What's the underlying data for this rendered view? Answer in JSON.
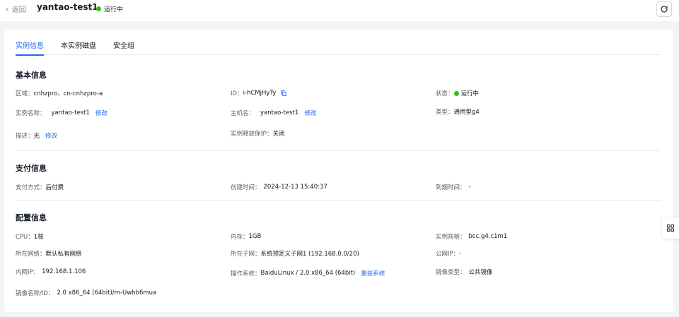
{
  "header": {
    "back_label": "返回",
    "instance_title": "yantao-test1",
    "status_text": "运行中",
    "status_color": "#30bf13"
  },
  "tabs": [
    {
      "label": "实例信息",
      "active": true
    },
    {
      "label": "本实例磁盘",
      "active": false
    },
    {
      "label": "安全组",
      "active": false
    }
  ],
  "basic": {
    "title": "基本信息",
    "region_label": "区域：",
    "region_value": "cnhzpro、cn-cnhzpro-a",
    "id_label": "ID：",
    "id_value": "i-hCMjHyTy",
    "state_label": "状态：",
    "state_value": "运行中",
    "name_label": "实例名称：",
    "name_value": "yantao-test1",
    "name_edit": "修改",
    "host_label": "主机名：",
    "host_value": "yantao-test1",
    "host_edit": "修改",
    "type_label": "类型：",
    "type_value": "通用型g4",
    "desc_label": "描述：",
    "desc_value": "无",
    "desc_edit": "修改",
    "protect_label": "实例释放保护：",
    "protect_value": "关闭"
  },
  "payment": {
    "title": "支付信息",
    "method_label": "支付方式：",
    "method_value": "后付费",
    "created_label": "创建时间：",
    "created_value": "2024-12-13 15:40:37",
    "expire_label": "到期时间：",
    "expire_value": "-"
  },
  "config": {
    "title": "配置信息",
    "cpu_label": "CPU：",
    "cpu_value": "1核",
    "mem_label": "内存：",
    "mem_value": "1GB",
    "spec_label": "实例规格：",
    "spec_value": "bcc.g4.c1m1",
    "network_label": "所在网络：",
    "network_value": "默认私有网络",
    "subnet_label": "所在子网：",
    "subnet_value": "系统预定义子网1 (192.168.0.0/20)",
    "public_ip_label": "公网IP：",
    "public_ip_value": "-",
    "private_ip_label": "内网IP：",
    "private_ip_value": "192.168.1.106",
    "os_label": "操作系统：",
    "os_value": "BaiduLinux / 2.0 x86_64 (64bit)",
    "os_action": "重装系统",
    "image_type_label": "镜像类型：",
    "image_type_value": "公共镜像",
    "image_name_label": "镜像名称/ID：",
    "image_name_value": "2.0 x86_64 (64bit)/m-Uwhb6mua"
  },
  "colors": {
    "accent": "#2468f2",
    "text": "#151b26",
    "label": "#5c5f66"
  }
}
